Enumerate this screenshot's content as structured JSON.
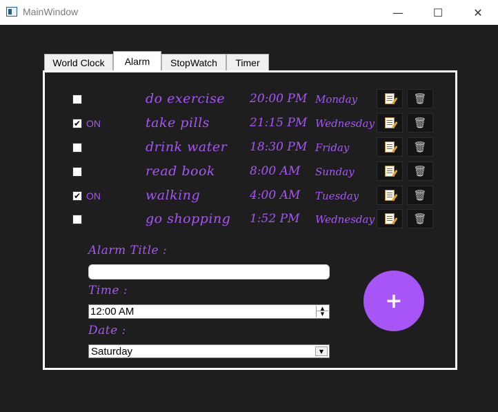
{
  "window": {
    "title": "MainWindow",
    "minimize": "—",
    "maximize": "☐",
    "close": "✕"
  },
  "tabs": [
    "World Clock",
    "Alarm",
    "StopWatch",
    "Timer"
  ],
  "active_tab": "Alarm",
  "accent_color": "#a855f7",
  "alarms": [
    {
      "checked": false,
      "state_label": "",
      "title": "do exercise",
      "time": "20:00 PM",
      "day": "Monday"
    },
    {
      "checked": true,
      "state_label": "ON",
      "title": "take pills",
      "time": "21:15 PM",
      "day": "Wednesday"
    },
    {
      "checked": false,
      "state_label": "",
      "title": "drink water",
      "time": "18:30 PM",
      "day": "Friday"
    },
    {
      "checked": false,
      "state_label": "",
      "title": "read book",
      "time": "8:00 AM",
      "day": "Sunday"
    },
    {
      "checked": true,
      "state_label": "ON",
      "title": "walking",
      "time": "4:00 AM",
      "day": "Tuesday"
    },
    {
      "checked": false,
      "state_label": "",
      "title": "go shopping",
      "time": "1:52 PM",
      "day": "Wednesday"
    }
  ],
  "form": {
    "title_label": "Alarm Title :",
    "title_value": "",
    "time_label": "Time :",
    "time_value": "12:00 AM",
    "date_label": "Date :",
    "date_value": "Saturday"
  },
  "add_button": "+",
  "icons": {
    "edit": "edit-notepad-icon",
    "delete": "trash-icon"
  }
}
